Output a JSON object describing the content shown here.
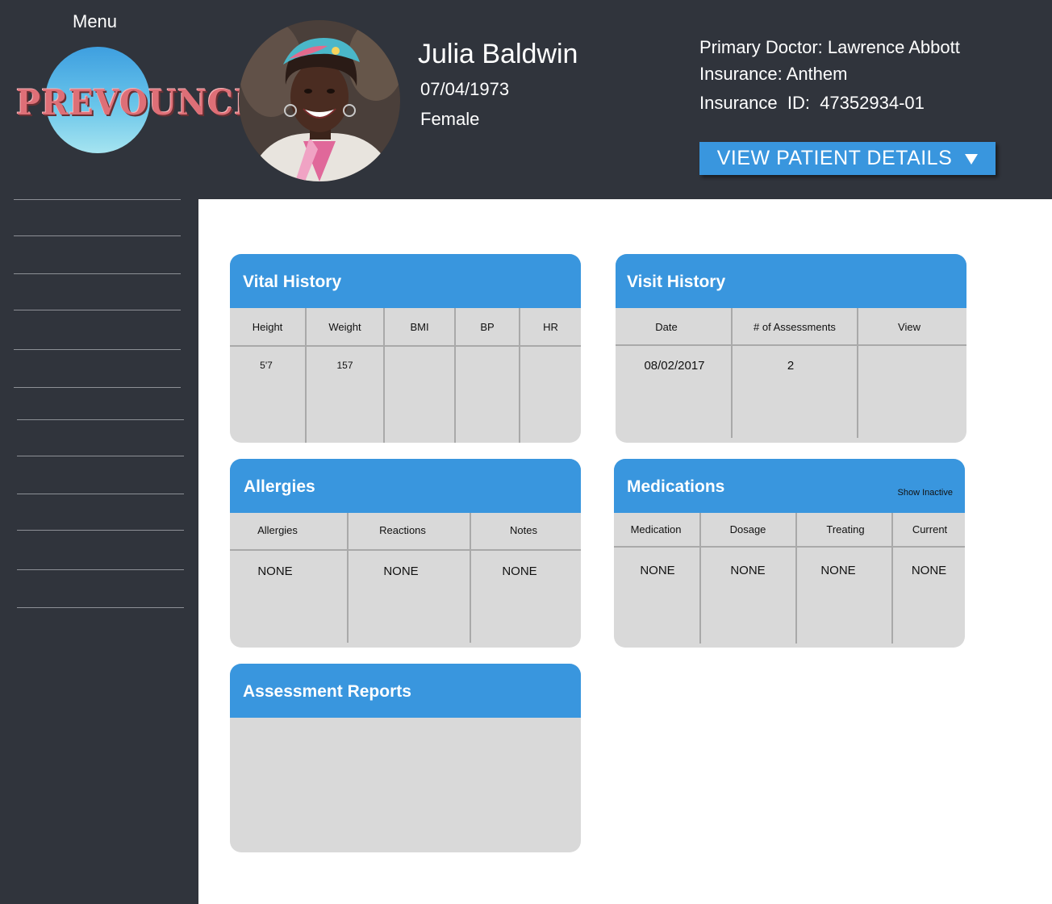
{
  "sidebar": {
    "menu_label": "Menu",
    "logo_text": "PREVOUNCE",
    "item_count": 12
  },
  "patient": {
    "name": "Julia Baldwin",
    "dob": "07/04/1973",
    "sex": "Female",
    "primary_doctor_label": "Primary Doctor:",
    "primary_doctor": "Lawrence Abbott",
    "insurance_label": "Insurance:",
    "insurance": "Anthem",
    "insurance_id_label": "Insurance  ID:",
    "insurance_id": "47352934-01",
    "details_button": "VIEW PATIENT DETAILS"
  },
  "vital_history": {
    "title": "Vital History",
    "columns": [
      "Height",
      "Weight",
      "BMI",
      "BP",
      "HR"
    ],
    "rows": [
      [
        "5'7",
        "157",
        "",
        "",
        ""
      ]
    ]
  },
  "visit_history": {
    "title": "Visit History",
    "columns": [
      "Date",
      "# of Assessments",
      "View"
    ],
    "rows": [
      [
        "08/02/2017",
        "2",
        ""
      ]
    ]
  },
  "allergies": {
    "title": "Allergies",
    "columns": [
      "Allergies",
      "Reactions",
      "Notes"
    ],
    "rows": [
      [
        "NONE",
        "NONE",
        "NONE"
      ]
    ]
  },
  "medications": {
    "title": "Medications",
    "show_inactive": "Show Inactive",
    "columns": [
      "Medication",
      "Dosage",
      "Treating",
      "Current"
    ],
    "rows": [
      [
        "NONE",
        "NONE",
        "NONE",
        "NONE"
      ]
    ]
  },
  "assessment_reports": {
    "title": "Assessment Reports"
  },
  "colors": {
    "header_bg": "#30343c",
    "accent": "#3996de",
    "card_body": "#d9d9d9",
    "logo_pink": "#de6f77"
  }
}
